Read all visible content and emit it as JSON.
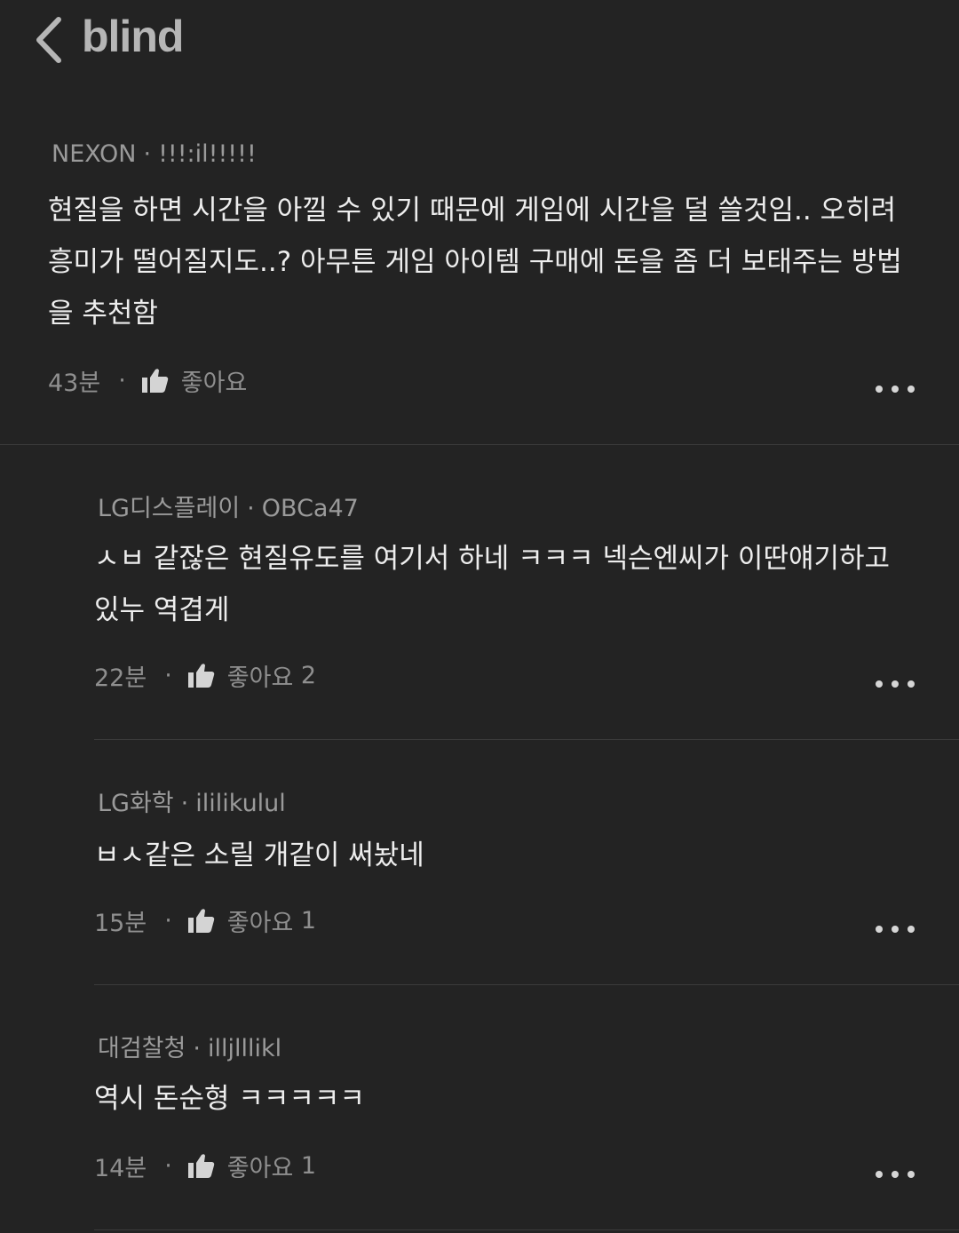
{
  "header": {
    "brand": "blind",
    "back_icon": "chevron-left-icon"
  },
  "comments": [
    {
      "company": "NEXON",
      "nickname": "!!!:il!!!!!",
      "text": "현질을 하면 시간을 아낄 수 있기 때문에 게임에 시간을 덜 쓸것임.. 오히려 흥미가 떨어질지도..? 아무튼 게임 아이템 구매에 돈을 좀 더 보태주는 방법을 추천함",
      "time": "43분",
      "like_label": "좋아요",
      "like_count": ""
    },
    {
      "company": "LG디스플레이",
      "nickname": "OBCa47",
      "text": "ㅅㅂ 같잖은 현질유도를 여기서 하네 ㅋㅋㅋ 넥슨엔씨가 이딴얘기하고 있누 역겹게",
      "time": "22분",
      "like_label": "좋아요",
      "like_count": "2"
    },
    {
      "company": "LG화학",
      "nickname": "ililikulul",
      "text": "ㅂㅅ같은 소릴 개같이 써놨네",
      "time": "15분",
      "like_label": "좋아요",
      "like_count": "1"
    },
    {
      "company": "대검찰청",
      "nickname": "illjlllikl",
      "text": "역시 돈순형 ㅋㅋㅋㅋㅋ",
      "time": "14분",
      "like_label": "좋아요",
      "like_count": "1"
    }
  ],
  "icons": {
    "like": "thumbs-up-icon",
    "more": "more-dots-icon"
  },
  "colors": {
    "background": "#232323",
    "text": "#ededed",
    "meta": "#9a9a9a",
    "divider": "#3b3b3b"
  }
}
